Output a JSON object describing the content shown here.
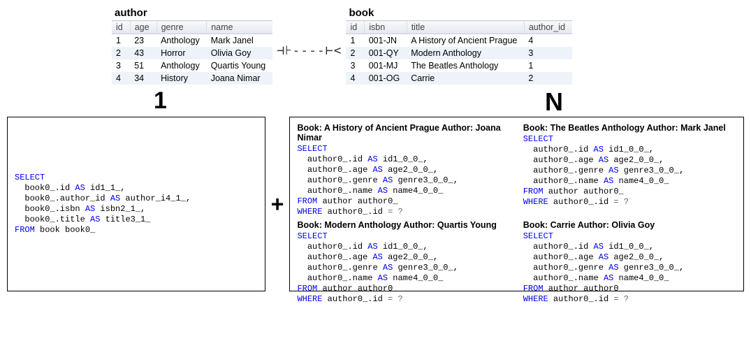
{
  "tables": {
    "author": {
      "title": "author",
      "columns": [
        "id",
        "age",
        "genre",
        "name"
      ],
      "rows": [
        [
          "1",
          "23",
          "Anthology",
          "Mark Janel"
        ],
        [
          "2",
          "43",
          "Horror",
          "Olivia Goy"
        ],
        [
          "3",
          "51",
          "Anthology",
          "Quartis Young"
        ],
        [
          "4",
          "34",
          "History",
          "Joana Nimar"
        ]
      ]
    },
    "book": {
      "title": "book",
      "columns": [
        "id",
        "isbn",
        "title",
        "author_id"
      ],
      "rows": [
        [
          "1",
          "001-JN",
          "A History of Ancient Prague",
          "4"
        ],
        [
          "2",
          "001-QY",
          "Modern Anthology",
          "3"
        ],
        [
          "3",
          "001-MJ",
          "The Beatles Anthology",
          "1"
        ],
        [
          "4",
          "001-OG",
          "Carrie",
          "2"
        ]
      ]
    }
  },
  "relation_glyph": "⊣⊦----⊢<",
  "legend": {
    "one": "1",
    "many": "N"
  },
  "plus": "+",
  "left_sql": {
    "lines": [
      {
        "t": "SELECT",
        "cls": "kw"
      },
      {
        "t": "  book0_.id AS id1_1_,"
      },
      {
        "t": "  book0_.author_id AS author_i4_1_,"
      },
      {
        "t": "  book0_.isbn AS isbn2_1_,"
      },
      {
        "t": "  book0_.title AS title3_1_"
      },
      {
        "t": "FROM book book0_",
        "cls": "kwprefix",
        "kw": "FROM",
        "rest": " book book0_"
      }
    ]
  },
  "right_sql": {
    "kw_select": "SELECT",
    "kw_from": "FROM",
    "kw_where": "WHERE",
    "kw_as": "AS",
    "body": [
      "  author0_.id AS id1_0_0_,",
      "  author0_.age AS age2_0_0_,",
      "  author0_.genre AS genre3_0_0_,",
      "  author0_.name AS name4_0_0_"
    ],
    "from_rest": " author author0_",
    "where_rest": " author0_.id = ?",
    "queries": [
      {
        "title": "Book: A History of Ancient Prague Author: Joana Nimar"
      },
      {
        "title": "Book: The Beatles Anthology Author: Mark Janel"
      },
      {
        "title": "Book: Modern Anthology Author: Quartis Young"
      },
      {
        "title": "Book: Carrie Author: Olivia Goy"
      }
    ]
  }
}
